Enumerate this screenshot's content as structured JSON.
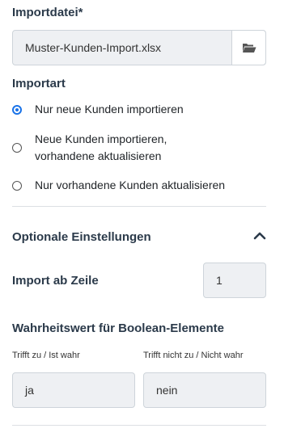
{
  "import_file": {
    "label": "Importdatei*",
    "value": "Muster-Kunden-Import.xlsx",
    "browse_icon": "folder-open-icon"
  },
  "import_type": {
    "label": "Importart",
    "options": [
      {
        "label_line1": "Nur neue Kunden importieren",
        "label_line2": "",
        "selected": true
      },
      {
        "label_line1": "Neue Kunden importieren,",
        "label_line2": "vorhandene aktualisieren",
        "selected": false
      },
      {
        "label_line1": "Nur vorhandene Kunden aktualisieren",
        "label_line2": "",
        "selected": false
      }
    ]
  },
  "optional_settings": {
    "title": "Optionale Einstellungen",
    "toggle_icon": "chevron-up-icon",
    "import_from_row": {
      "label": "Import ab Zeile",
      "value": "1"
    },
    "boolean_values": {
      "title": "Wahrheitswert für Boolean-Elemente",
      "true_label": "Trifft zu / Ist wahr",
      "true_value": "ja",
      "false_label": "Trifft nicht zu / Nicht wahr",
      "false_value": "nein"
    }
  },
  "colors": {
    "accent": "#1a73e8",
    "input_bg": "#eef0f3",
    "border": "#ced4da"
  }
}
